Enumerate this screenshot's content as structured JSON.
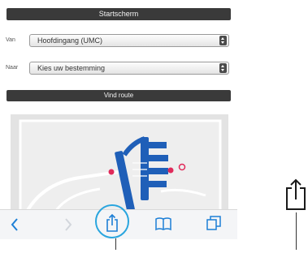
{
  "header": {
    "title": "Startscherm"
  },
  "form": {
    "from_label": "Van",
    "from_value": "Hoofdingang (UMC)",
    "to_label": "Naar",
    "to_value": "Kies uw bestemming",
    "route_button": "Vind route"
  },
  "toolbar": {
    "items": [
      "back-icon",
      "forward-icon",
      "share-icon",
      "bookmarks-icon",
      "tabs-icon"
    ]
  },
  "colors": {
    "dark_bar": "#3a3a3a",
    "ios_blue": "#1d7fd6",
    "highlight": "#29a5de",
    "marker": "#e02a5a"
  }
}
